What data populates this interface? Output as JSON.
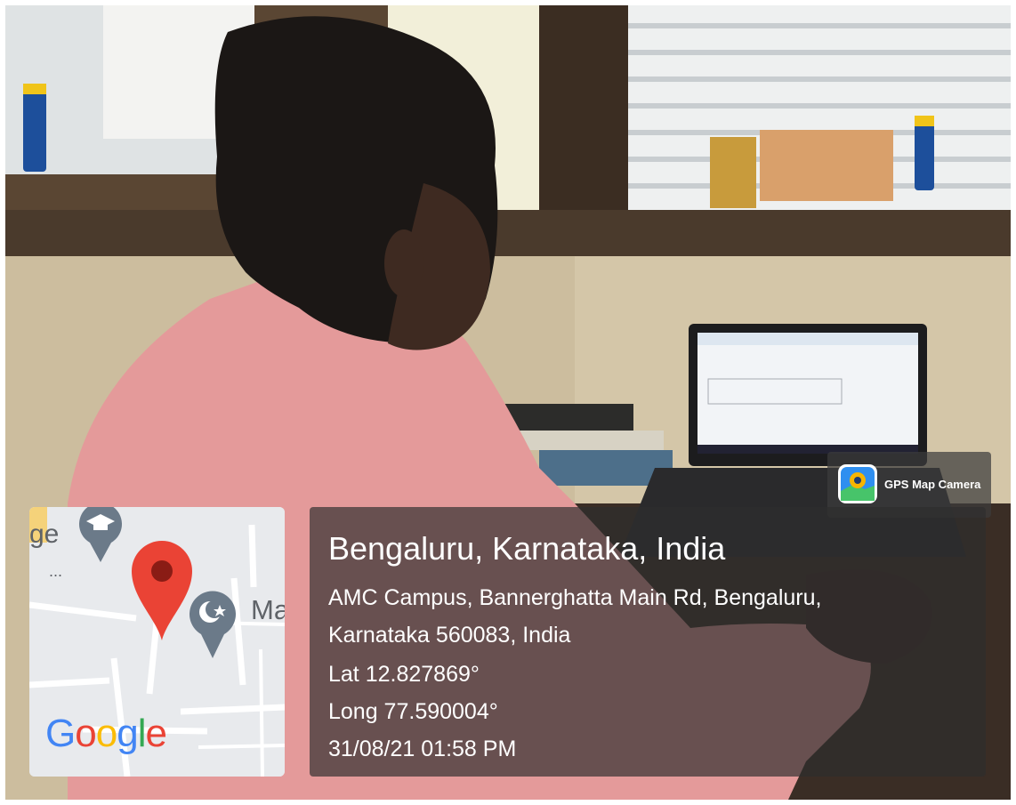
{
  "photo": {
    "description_icon": "gps-map-camera-icon"
  },
  "stamp": {
    "app_name": "GPS Map Camera"
  },
  "map": {
    "logo": [
      "G",
      "o",
      "o",
      "g",
      "l",
      "e"
    ],
    "label_left": "ge",
    "label_right": "Ma",
    "dots": "...",
    "pin_icon": "location-pin-icon",
    "school_icon": "graduation-cap-icon",
    "mosque_icon": "crescent-star-icon"
  },
  "location": {
    "title": "Bengaluru, Karnataka, India",
    "address_line1": "AMC Campus, Bannerghatta Main Rd, Bengaluru,",
    "address_line2": "Karnataka 560083, India",
    "lat": "Lat 12.827869°",
    "long": "Long 77.590004°",
    "datetime": "31/08/21 01:58 PM"
  },
  "colors": {
    "pin_red": "#EA4335",
    "map_bg": "#e8eaed",
    "panel_bg": "#2d2d2d"
  }
}
